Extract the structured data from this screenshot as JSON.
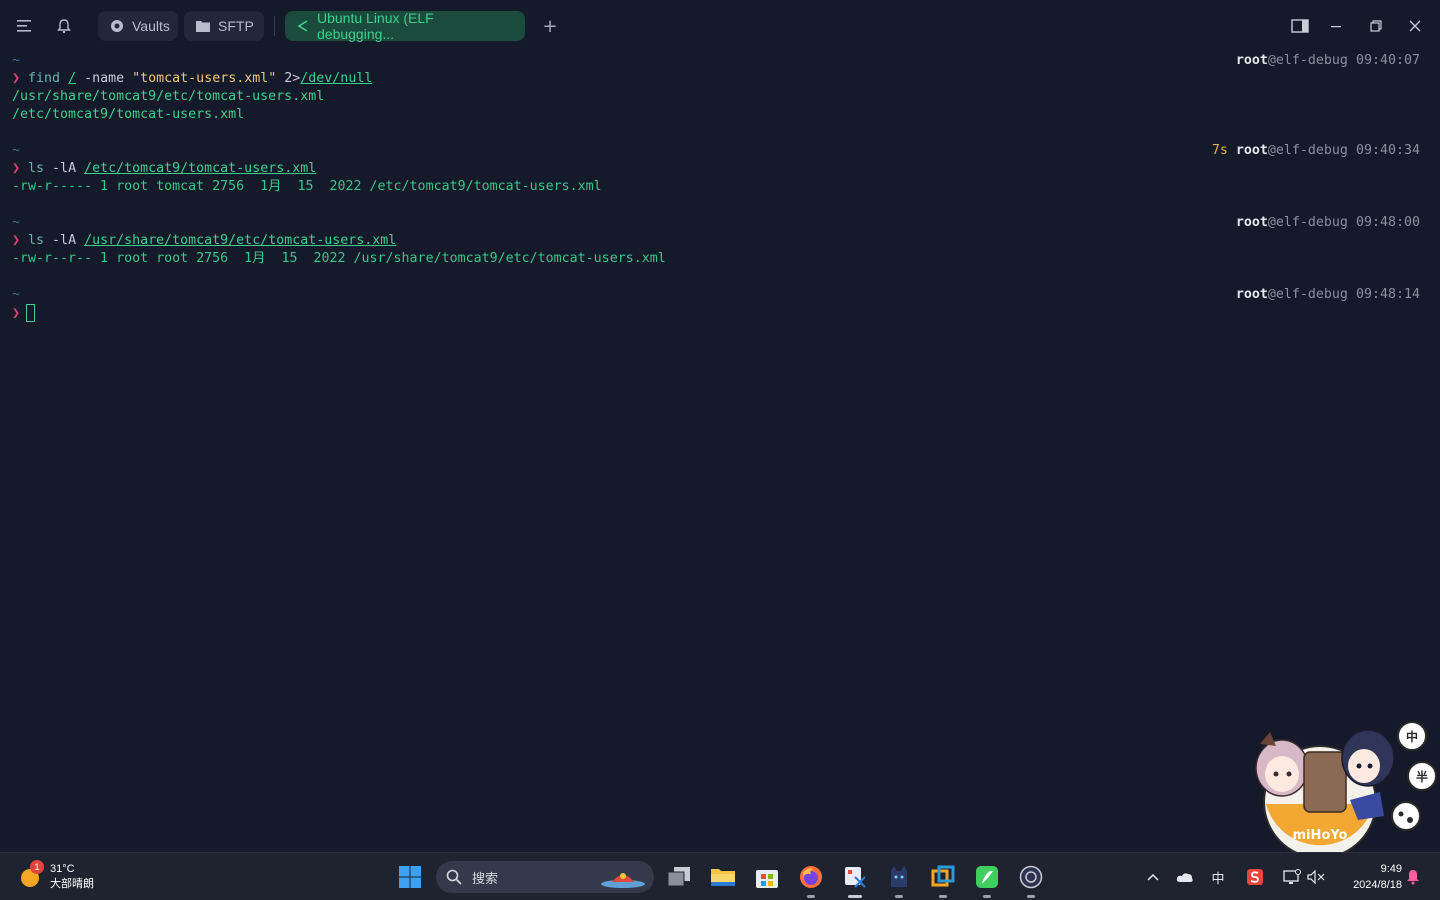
{
  "titlebar": {
    "tabs": [
      {
        "label": "Vaults",
        "icon": "vault-icon"
      },
      {
        "label": "SFTP",
        "icon": "folder-icon"
      },
      {
        "label": "Ubuntu Linux (ELF debugging...",
        "icon": "ssh-terminal-icon",
        "active": true
      }
    ],
    "new_tab_label": "+"
  },
  "terminal": {
    "blocks": [
      {
        "tilde": "~",
        "right_user": "root",
        "right_host": "@elf-debug",
        "right_time": "09:40:07",
        "duration": "",
        "cmd": "find",
        "args": [
          " ",
          "/",
          " -name ",
          "\"tomcat-users.xml\"",
          " 2>",
          "/dev/null"
        ],
        "output": [
          "/usr/share/tomcat9/etc/tomcat-users.xml",
          "/etc/tomcat9/tomcat-users.xml"
        ]
      },
      {
        "tilde": "~",
        "right_user": "root",
        "right_host": "@elf-debug",
        "right_time": "09:40:34",
        "duration": "7s",
        "cmd": "ls",
        "arg_flag": " -lA ",
        "arg_path": "/etc/tomcat9/tomcat-users.xml",
        "output": [
          "-rw-r----- 1 root tomcat 2756  1月  15  2022 /etc/tomcat9/tomcat-users.xml"
        ]
      },
      {
        "tilde": "~",
        "right_user": "root",
        "right_host": "@elf-debug",
        "right_time": "09:48:00",
        "duration": "",
        "cmd": "ls",
        "arg_flag": " -lA ",
        "arg_path": "/usr/share/tomcat9/etc/tomcat-users.xml",
        "output": [
          "-rw-r--r-- 1 root root 2756  1月  15  2022 /usr/share/tomcat9/etc/tomcat-users.xml"
        ]
      },
      {
        "tilde": "~",
        "right_user": "root",
        "right_host": "@elf-debug",
        "right_time": "09:48:14"
      }
    ],
    "prompt_symbol": "❯"
  },
  "mascot": {
    "badge_text": "miHoYo",
    "bubbles": [
      "中",
      "半"
    ]
  },
  "taskbar": {
    "weather_temp": "31°C",
    "weather_desc": "大部晴朗",
    "weather_badge": "1",
    "search_placeholder": "搜索",
    "apps": [
      "windows-start-icon",
      "task-view-icon",
      "file-explorer-icon",
      "microsoft-store-icon",
      "firefox-icon",
      "snipping-tool-icon",
      "cat-app-icon",
      "remote-app-icon",
      "green-app-icon",
      "circle-app-icon"
    ],
    "tray": {
      "ime": "中"
    },
    "time": "9:49",
    "date": "2024/8/18"
  },
  "colors": {
    "background": "#151a2a",
    "accent_green": "#3ecf8e",
    "prompt_arrow": "#e0407a",
    "string_yellow": "#f0c674",
    "duration": "#e5b24e"
  }
}
